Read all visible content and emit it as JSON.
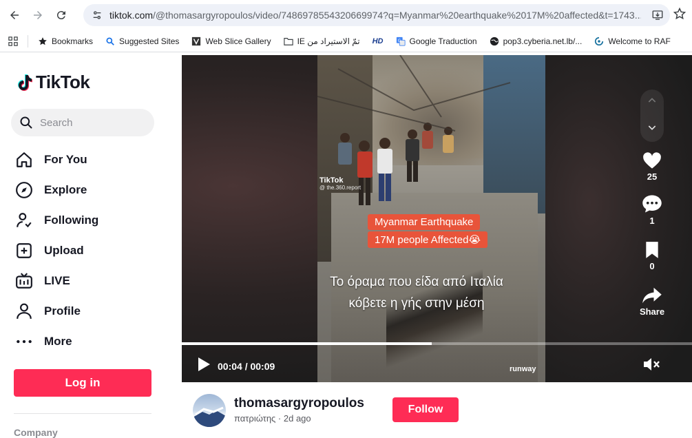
{
  "browser": {
    "url_host": "tiktok.com",
    "url_rest": "/@thomasargyropoulos/video/7486978554320669974?q=Myanmar%20earthquake%2017M%20affected&t=1743...",
    "bookmarks": [
      {
        "label": "Bookmarks",
        "icon": "star-icon"
      },
      {
        "label": "Suggested Sites",
        "icon": "search-icon"
      },
      {
        "label": "Web Slice Gallery",
        "icon": "web-slice-icon"
      },
      {
        "label": "IE تمّ الاستيراد من",
        "icon": "folder-icon"
      },
      {
        "label": "",
        "icon": "hd-icon",
        "text": "HD"
      },
      {
        "label": "Google Traduction",
        "icon": "translate-icon"
      },
      {
        "label": "pop3.cyberia.net.lb/...",
        "icon": "globe-icon"
      },
      {
        "label": "Welcome to RAF",
        "icon": "raf-icon"
      }
    ]
  },
  "sidebar": {
    "logo": "TikTok",
    "search_placeholder": "Search",
    "items": [
      {
        "label": "For You",
        "icon": "home-icon"
      },
      {
        "label": "Explore",
        "icon": "compass-icon"
      },
      {
        "label": "Following",
        "icon": "following-icon"
      },
      {
        "label": "Upload",
        "icon": "upload-icon"
      },
      {
        "label": "LIVE",
        "icon": "live-icon"
      },
      {
        "label": "Profile",
        "icon": "profile-icon"
      },
      {
        "label": "More",
        "icon": "more-icon"
      }
    ],
    "login": "Log in",
    "company": "Company"
  },
  "video": {
    "watermark_logo": "TikTok",
    "watermark_user": "@ the.360.report",
    "caption_line1": "Myanmar Earthquake",
    "caption_line2": "17M people Affected😭",
    "greek_line1": "Το όραμα που είδα από Ιταλία",
    "greek_line2": "κόβετε η γής στην μέση",
    "time": "00:04 / 00:09",
    "progress": 0.49,
    "runway": "runway",
    "likes": "25",
    "comments": "1",
    "saves": "0",
    "share": "Share"
  },
  "author": {
    "username": "thomasargyropoulos",
    "subtitle": "πατριώτης · 2d ago",
    "follow": "Follow"
  },
  "colors": {
    "brand": "#fe2c55",
    "caption_bg": "#e8543a"
  }
}
